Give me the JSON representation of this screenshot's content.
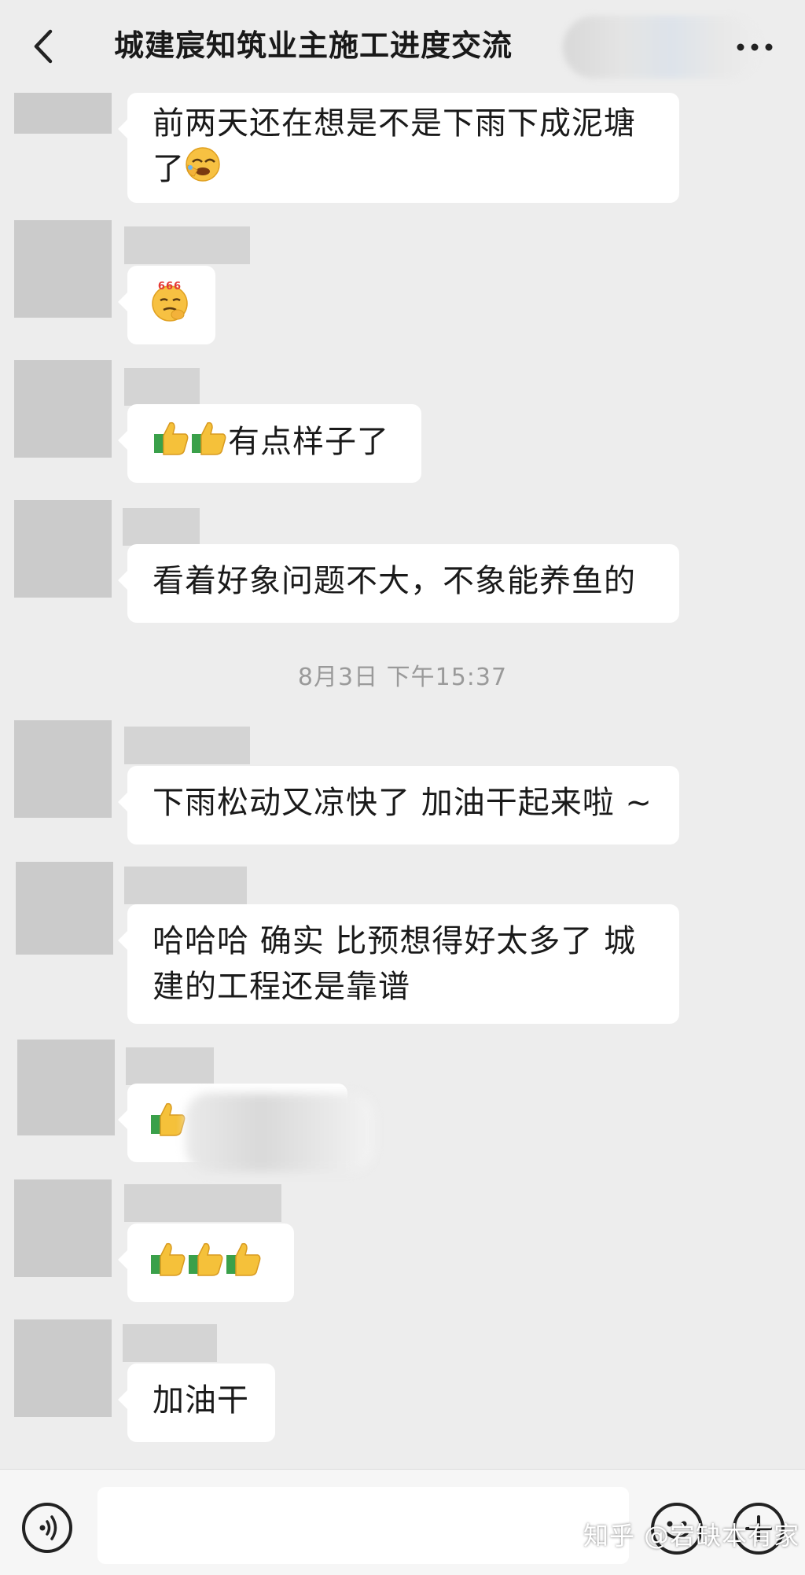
{
  "header": {
    "title": "城建宸知筑业主施工进度交流"
  },
  "messages": [
    {
      "text": "前两天还在想是不是下雨下成泥塘了"
    },
    {
      "emoji": "thinking-666-emoji"
    },
    {
      "emoji": "thumbs-up-emoji",
      "text": "有点样子了"
    },
    {
      "text": "看着好象问题不大，不象能养鱼的"
    },
    {
      "text": "下雨松动又凉快了 加油干起来啦 ~"
    },
    {
      "text": "哈哈哈 确实 比预想得好太多了 城建的工程还是靠谱"
    },
    {
      "emoji": "thumbs-up-emoji"
    },
    {
      "emoji": "thumbs-up-emoji"
    },
    {
      "text": "加油干"
    }
  ],
  "timestamp": "8月3日 下午15:37",
  "watermark": "知乎 @宕缺本有家",
  "emoji_glyph_text": "666",
  "icons": [
    "back-icon",
    "more-icon",
    "voice-icon",
    "emoji-icon",
    "plus-icon",
    "thumbs-up-icon",
    "face-palm-emoji",
    "thinking-666-emoji"
  ]
}
